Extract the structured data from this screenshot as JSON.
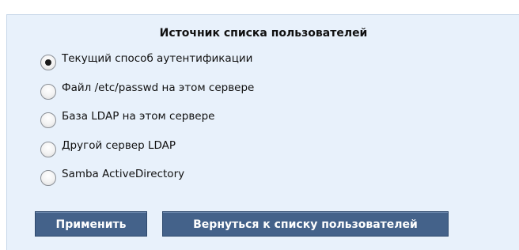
{
  "form": {
    "title": "Источник списка пользователей",
    "options": [
      {
        "label": "Текущий способ аутентификации",
        "selected": true
      },
      {
        "label": "Файл /etc/passwd на этом сервере",
        "selected": false
      },
      {
        "label": "База LDAP на этом сервере",
        "selected": false
      },
      {
        "label": "Другой сервер LDAP",
        "selected": false
      },
      {
        "label": "Samba ActiveDirectory",
        "selected": false
      }
    ],
    "apply_label": "Применить",
    "back_label": "Вернуться к списку пользователей"
  },
  "colors": {
    "panel_background": "#e8f1fb",
    "button_background": "#44628a",
    "button_text": "#ffffff"
  }
}
